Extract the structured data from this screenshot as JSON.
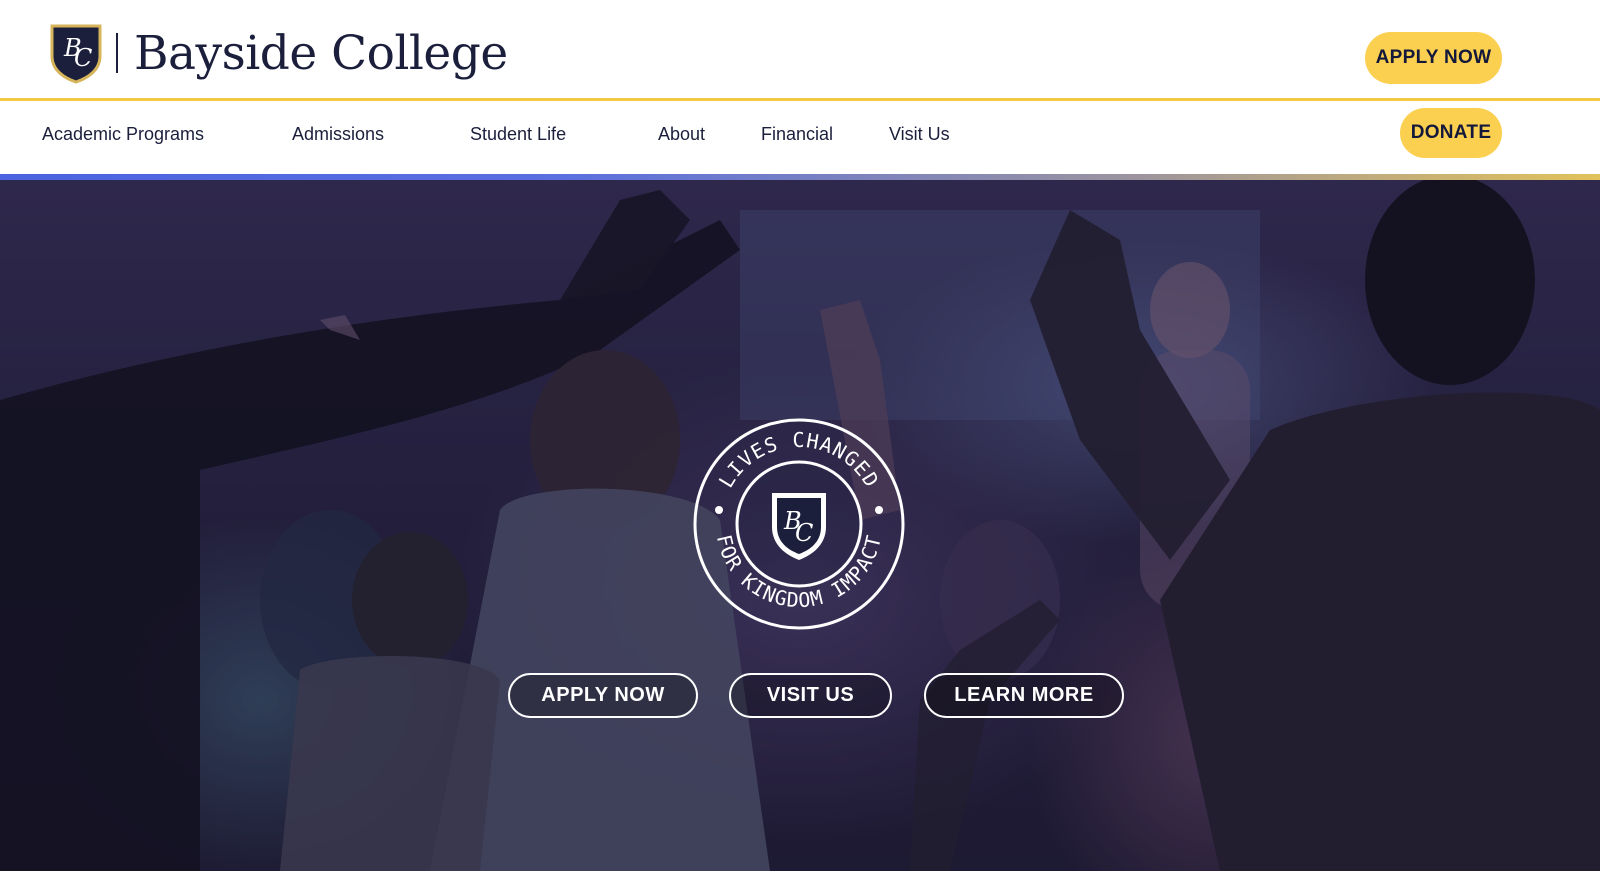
{
  "brand": {
    "name": "Bayside College",
    "monogram": "BC",
    "colors": {
      "navy": "#1b1f3b",
      "gold": "#fbd050"
    }
  },
  "header": {
    "apply_label": "APPLY NOW",
    "donate_label": "DONATE"
  },
  "nav": {
    "items": [
      {
        "label": "Academic Programs"
      },
      {
        "label": "Admissions"
      },
      {
        "label": "Student Life"
      },
      {
        "label": "About"
      },
      {
        "label": "Financial"
      },
      {
        "label": "Visit Us"
      }
    ]
  },
  "hero": {
    "seal_top_text": "LIVES CHANGED",
    "seal_bottom_text": "FOR KINGDOM IMPACT",
    "buttons": {
      "apply": "APPLY NOW",
      "visit": "VISIT US",
      "learn": "LEARN MORE"
    }
  }
}
